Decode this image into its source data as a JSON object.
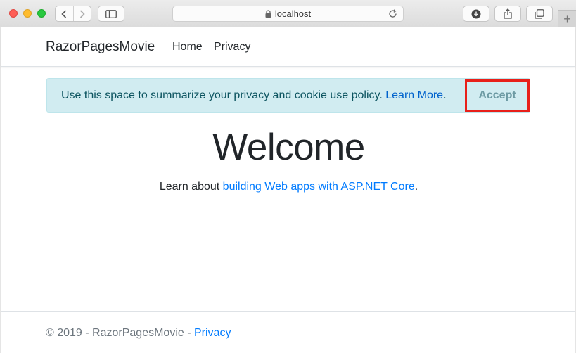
{
  "browser": {
    "address": "localhost"
  },
  "navbar": {
    "brand": "RazorPagesMovie",
    "links": [
      "Home",
      "Privacy"
    ]
  },
  "consent": {
    "text": "Use this space to summarize your privacy and cookie use policy.",
    "link": "Learn More",
    "after_link": ".",
    "button": "Accept"
  },
  "main": {
    "heading": "Welcome",
    "intro_prefix": "Learn about ",
    "intro_link": "building Web apps with ASP.NET Core",
    "intro_suffix": "."
  },
  "footer": {
    "copyright": "© 2019 - RazorPagesMovie - ",
    "link": "Privacy"
  },
  "colors": {
    "link": "#007bff",
    "consent_bg": "#d1ecf1",
    "highlight": "#e8201a"
  }
}
